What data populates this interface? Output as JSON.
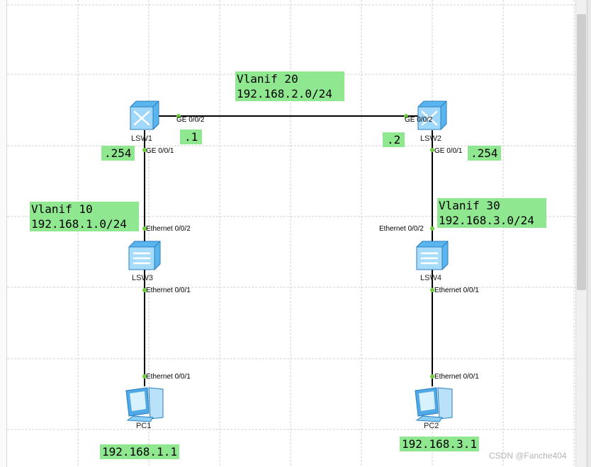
{
  "links": [
    {
      "id": "lsw1-lsw2"
    },
    {
      "id": "lsw1-lsw3"
    },
    {
      "id": "lsw2-lsw4"
    },
    {
      "id": "lsw3-pc1"
    },
    {
      "id": "lsw4-pc2"
    }
  ],
  "devices": {
    "lsw1": {
      "name": "LSW1",
      "type": "layer3-switch-icon"
    },
    "lsw2": {
      "name": "LSW2",
      "type": "layer3-switch-icon"
    },
    "lsw3": {
      "name": "LSW3",
      "type": "layer2-switch-icon"
    },
    "lsw4": {
      "name": "LSW4",
      "type": "layer2-switch-icon"
    },
    "pc1": {
      "name": "PC1",
      "type": "pc-icon"
    },
    "pc2": {
      "name": "PC2",
      "type": "pc-icon"
    }
  },
  "ports": {
    "lsw1_ge002": "GE 0/0/2",
    "lsw2_ge002": "GE 0/0/2",
    "lsw1_ge001": "GE 0/0/1",
    "lsw2_ge001": "GE 0/0/1",
    "lsw3_e002": "Ethernet 0/0/2",
    "lsw4_e002": "Ethernet 0/0/2",
    "lsw3_e001": "Ethernet 0/0/1",
    "lsw4_e001": "Ethernet 0/0/1",
    "pc1_e001": "Ethernet 0/0/1",
    "pc2_e001": "Ethernet 0/0/1"
  },
  "annotations": {
    "vlanif20": "Vlanif 20\n192.168.2.0/24",
    "vlanif10": "Vlanif 10\n192.168.1.0/24",
    "vlanif30": "Vlanif 30\n192.168.3.0/24",
    "lsw1_ip_g2": ".1",
    "lsw2_ip_g2": ".2",
    "lsw1_ip_g1": ".254",
    "lsw2_ip_g1": ".254",
    "pc1_ip": "192.168.1.1",
    "pc2_ip": "192.168.3.1"
  },
  "watermark": "CSDN @Fanche404",
  "colors": {
    "label_bg": "#8fe88f",
    "link": "#000000",
    "port_dot": "#6ccf3a",
    "grid": "#d0d0d0",
    "switch_blue": "#4aa8e8"
  }
}
